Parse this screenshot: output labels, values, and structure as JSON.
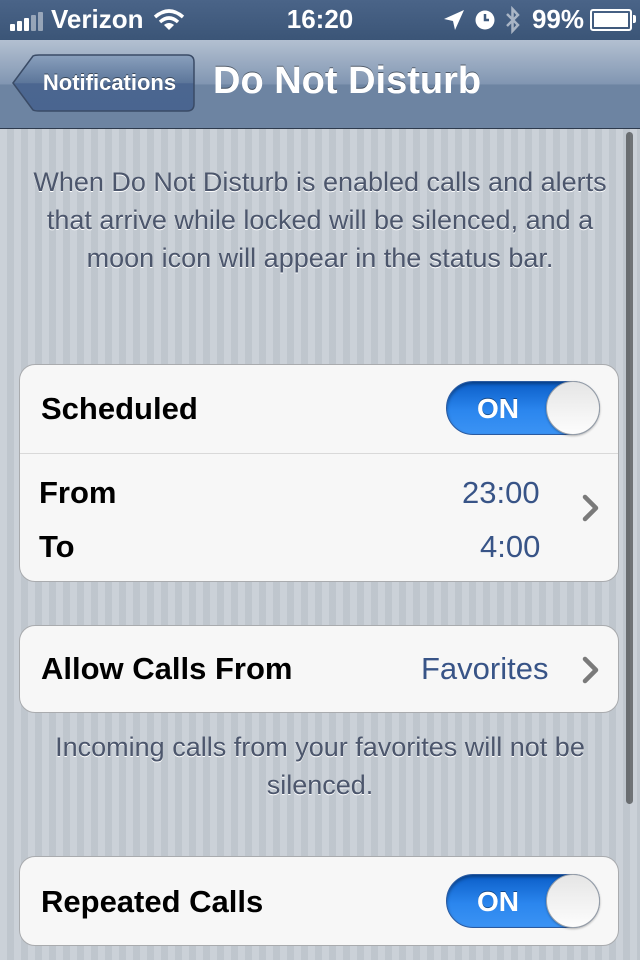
{
  "status_bar": {
    "carrier": "Verizon",
    "time": "16:20",
    "battery": "99%",
    "battery_level": 0.99
  },
  "nav": {
    "back_label": "Notifications",
    "title": "Do Not Disturb"
  },
  "description": "When Do Not Disturb is enabled calls and alerts that arrive while locked will be silenced, and a moon icon will appear in the status bar.",
  "scheduled": {
    "label": "Scheduled",
    "toggle": "ON",
    "on": true
  },
  "schedule": {
    "from_label": "From",
    "from_value": "23:00",
    "to_label": "To",
    "to_value": "4:00"
  },
  "allow_calls": {
    "label": "Allow Calls From",
    "value": "Favorites"
  },
  "allow_calls_note": "Incoming calls from your favorites will not be silenced.",
  "repeated_calls": {
    "label": "Repeated Calls",
    "toggle": "ON",
    "on": true
  },
  "icons": [
    "signal-bars-icon",
    "wifi-icon",
    "location-arrow-icon",
    "alarm-clock-icon",
    "bluetooth-icon",
    "battery-icon",
    "chevron-right-icon"
  ],
  "colors": {
    "toggle_on": "#2b86ee",
    "value_text": "#385487",
    "nav_bar": "#6d84a2"
  }
}
